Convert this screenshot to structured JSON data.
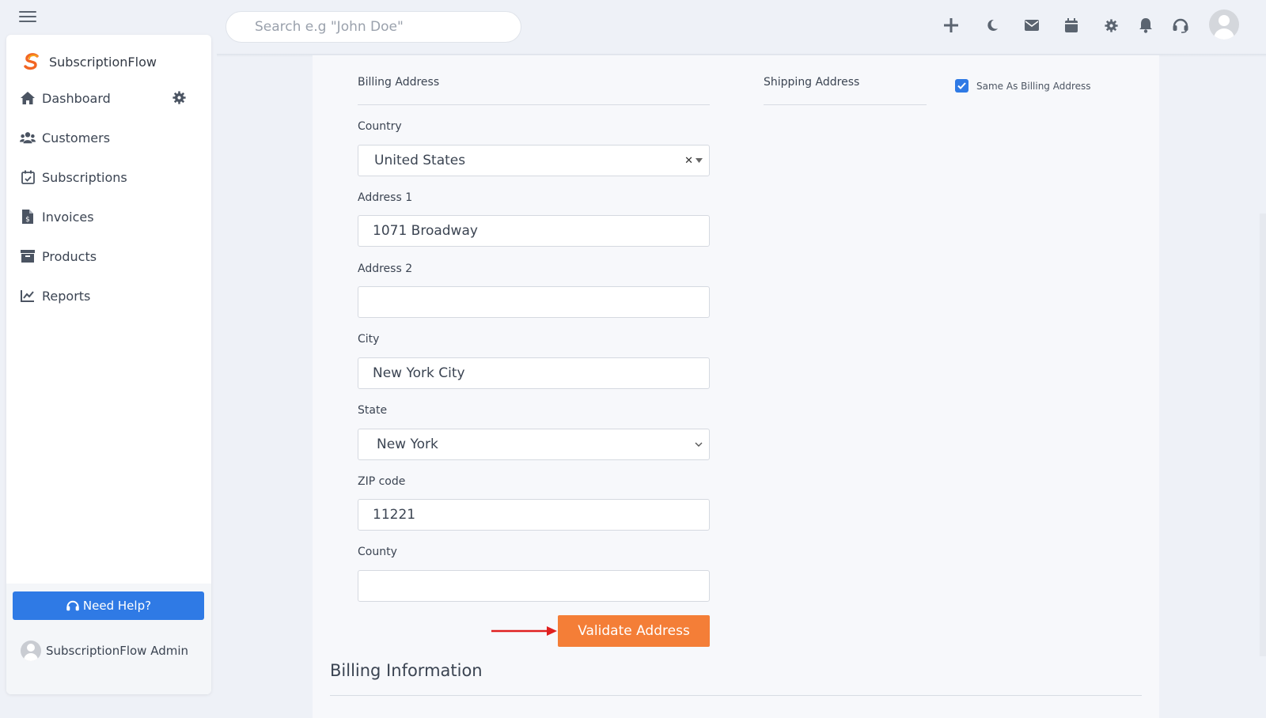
{
  "search": {
    "placeholder": "Search e.g \"John Doe\""
  },
  "brand": {
    "name": "SubscriptionFlow"
  },
  "sidebar": {
    "items": [
      {
        "label": "Dashboard",
        "icon": "home-icon"
      },
      {
        "label": "Customers",
        "icon": "users-icon"
      },
      {
        "label": "Subscriptions",
        "icon": "calendar-check-icon"
      },
      {
        "label": "Invoices",
        "icon": "invoice-icon"
      },
      {
        "label": "Products",
        "icon": "archive-icon"
      },
      {
        "label": "Reports",
        "icon": "chart-line-icon"
      }
    ],
    "help_label": "Need Help?",
    "admin_name": "SubscriptionFlow Admin"
  },
  "topbar": {
    "icons": [
      "plus-icon",
      "moon-icon",
      "envelope-icon",
      "calendar-icon",
      "gear-icon",
      "bell-icon",
      "headset-icon",
      "avatar"
    ]
  },
  "form": {
    "billing_heading": "Billing Address",
    "shipping_heading": "Shipping Address",
    "same_as_billing_label": "Same As Billing Address",
    "same_as_billing_checked": true,
    "country": {
      "label": "Country",
      "value": "United States"
    },
    "address1": {
      "label": "Address 1",
      "value": "1071 Broadway"
    },
    "address2": {
      "label": "Address 2",
      "value": ""
    },
    "city": {
      "label": "City",
      "value": "New York City"
    },
    "state": {
      "label": "State",
      "value": "New York"
    },
    "zip": {
      "label": "ZIP code",
      "value": "11221"
    },
    "county": {
      "label": "County",
      "value": ""
    },
    "validate_label": "Validate Address"
  },
  "billing_info_heading": "Billing Information",
  "colors": {
    "accent": "#2f7ae5",
    "validate_button": "#f47e37",
    "arrow": "#e02020"
  }
}
